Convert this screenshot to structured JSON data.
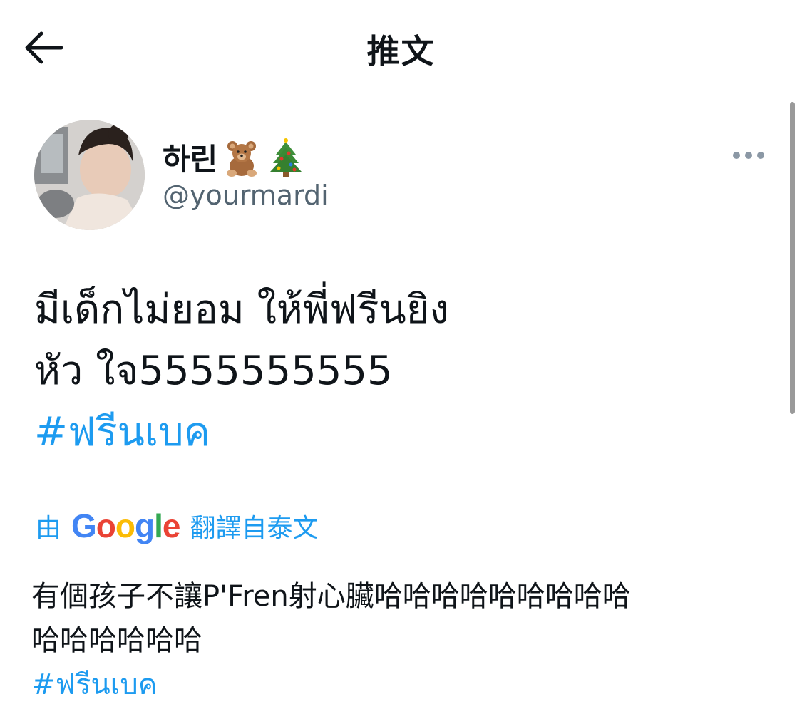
{
  "header": {
    "title": "推文"
  },
  "author": {
    "display_name": "하린",
    "emojis": [
      "teddy-bear",
      "christmas-tree"
    ],
    "handle": "@yourmardi"
  },
  "tweet": {
    "lines": [
      "มีเด็กไม่ยอม ให้พี่ฟรีนยิง",
      "หัว ใจ5555555555"
    ],
    "hashtag": "#ฟรีนเบค"
  },
  "translation": {
    "prefix": "由",
    "provider": "Google",
    "suffix": "翻譯自泰文",
    "lines": [
      "有個孩子不讓P'Fren射心臟哈哈哈哈哈哈哈哈哈",
      "哈哈哈哈哈哈"
    ],
    "hashtag": "#ฟรีนเบค"
  },
  "colors": {
    "link": "#1d9bf0",
    "secondary_text": "#536471",
    "more_dots": "#8b98a5"
  }
}
